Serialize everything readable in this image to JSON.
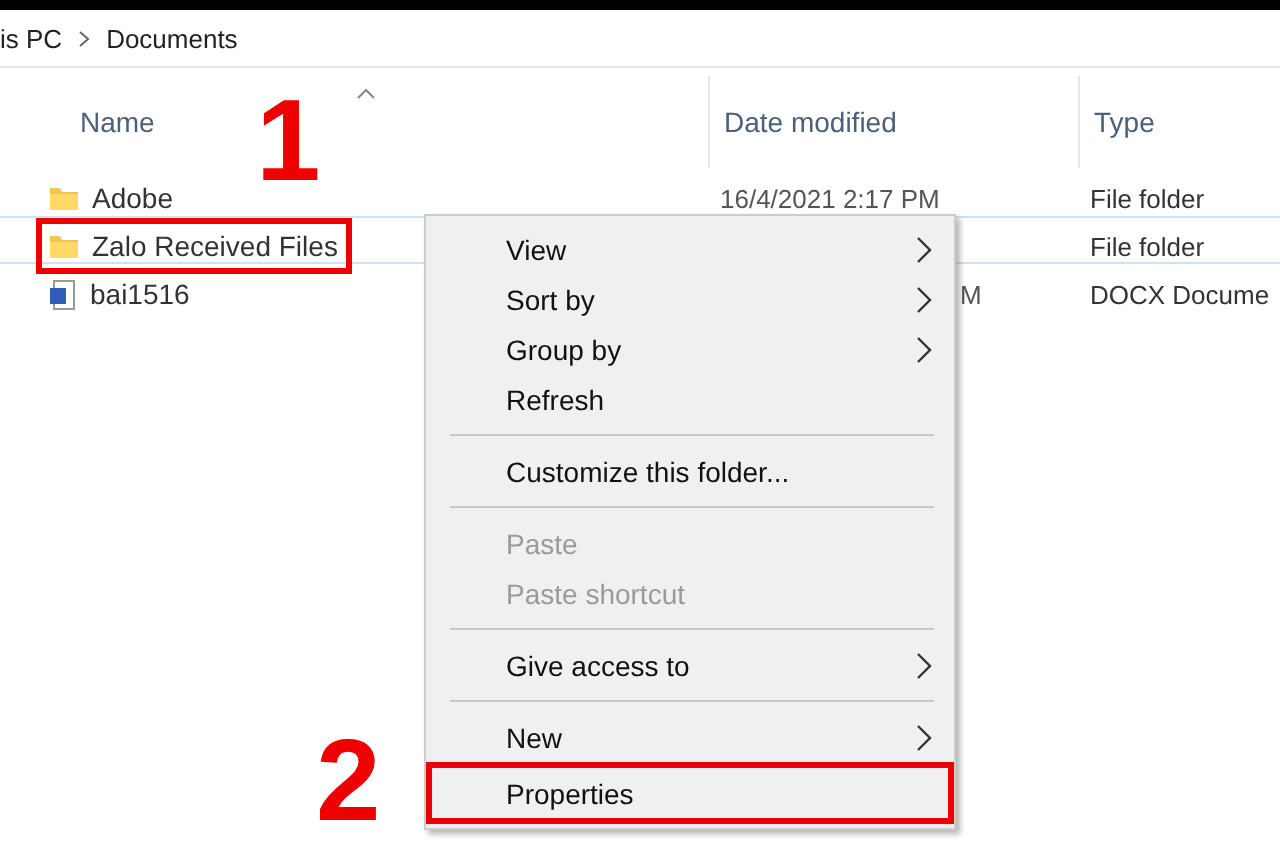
{
  "breadcrumb": [
    "is PC",
    "Documents"
  ],
  "columns": [
    {
      "label": "Name",
      "sorted": true
    },
    {
      "label": "Date modified",
      "sorted": false
    },
    {
      "label": "Type",
      "sorted": false
    }
  ],
  "rows": [
    {
      "name": "Adobe",
      "kind": "folder",
      "date": "16/4/2021 2:17 PM",
      "type": "File folder",
      "focused": false,
      "outlined": false
    },
    {
      "name": "Zalo Received Files",
      "kind": "folder",
      "type": "File folder",
      "focused": true,
      "outlined": true
    },
    {
      "name": "bai1516",
      "kind": "document",
      "date": "M",
      "date_covered": true,
      "type": "DOCX Docume",
      "focused": false,
      "outlined": false
    }
  ],
  "context_menu": [
    {
      "kind": "item",
      "label": "View",
      "submenu": true,
      "disabled": false,
      "outlined": false
    },
    {
      "kind": "item",
      "label": "Sort by",
      "submenu": true,
      "disabled": false,
      "outlined": false
    },
    {
      "kind": "item",
      "label": "Group by",
      "submenu": true,
      "disabled": false,
      "outlined": false
    },
    {
      "kind": "item",
      "label": "Refresh",
      "submenu": false,
      "disabled": false,
      "outlined": false
    },
    {
      "kind": "separator"
    },
    {
      "kind": "item",
      "label": "Customize this folder...",
      "submenu": false,
      "disabled": false,
      "outlined": false
    },
    {
      "kind": "separator"
    },
    {
      "kind": "item",
      "label": "Paste",
      "submenu": false,
      "disabled": true,
      "outlined": false
    },
    {
      "kind": "item",
      "label": "Paste shortcut",
      "submenu": false,
      "disabled": true,
      "outlined": false
    },
    {
      "kind": "separator"
    },
    {
      "kind": "item",
      "label": "Give access to",
      "submenu": true,
      "disabled": false,
      "outlined": false
    },
    {
      "kind": "separator"
    },
    {
      "kind": "item",
      "label": "New",
      "submenu": true,
      "disabled": false,
      "outlined": false
    },
    {
      "kind": "item",
      "label": "Properties",
      "submenu": false,
      "disabled": false,
      "outlined": true
    }
  ],
  "step_labels": [
    "1",
    "2"
  ]
}
